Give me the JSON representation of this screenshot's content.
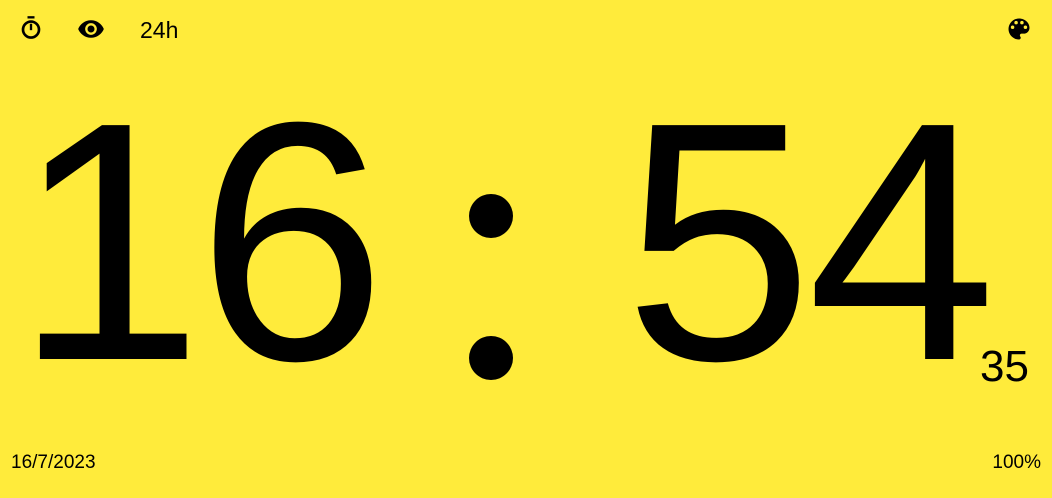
{
  "toolbar": {
    "stopwatch_icon": "stopwatch-icon",
    "visibility_icon": "eye-icon",
    "format_label": "24h",
    "palette_icon": "palette-icon"
  },
  "clock": {
    "hours": "16",
    "minutes": "54",
    "seconds": "35"
  },
  "footer": {
    "date": "16/7/2023",
    "battery": "100%"
  },
  "colors": {
    "background": "#FFEB3B",
    "foreground": "#000000"
  }
}
